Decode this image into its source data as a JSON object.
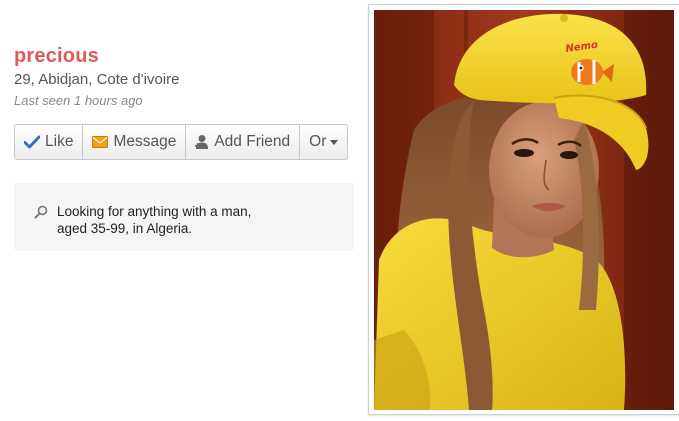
{
  "profile": {
    "name": "precious",
    "details": "29, Abidjan, Cote d'ivoire",
    "last_seen": "Last seen 1 hours ago"
  },
  "actions": {
    "like_label": "Like",
    "message_label": "Message",
    "add_friend_label": "Add Friend",
    "or_label": "Or"
  },
  "looking_for": {
    "line1": "Looking for anything with a man,",
    "line2": "aged 35-99, in Algeria."
  },
  "photo": {
    "cap_text": "Nemo"
  },
  "colors": {
    "name": "#e05a5a",
    "like_check": "#3a6fc4",
    "message_envelope": "#f0a020",
    "cap": "#f4d21e",
    "shirt": "#f2d025",
    "background_wall": "#8a2a14"
  },
  "icons": {
    "like": "check-icon",
    "message": "envelope-icon",
    "add_friend": "person-add-icon",
    "or": "caret-down-icon",
    "looking": "search-icon"
  }
}
